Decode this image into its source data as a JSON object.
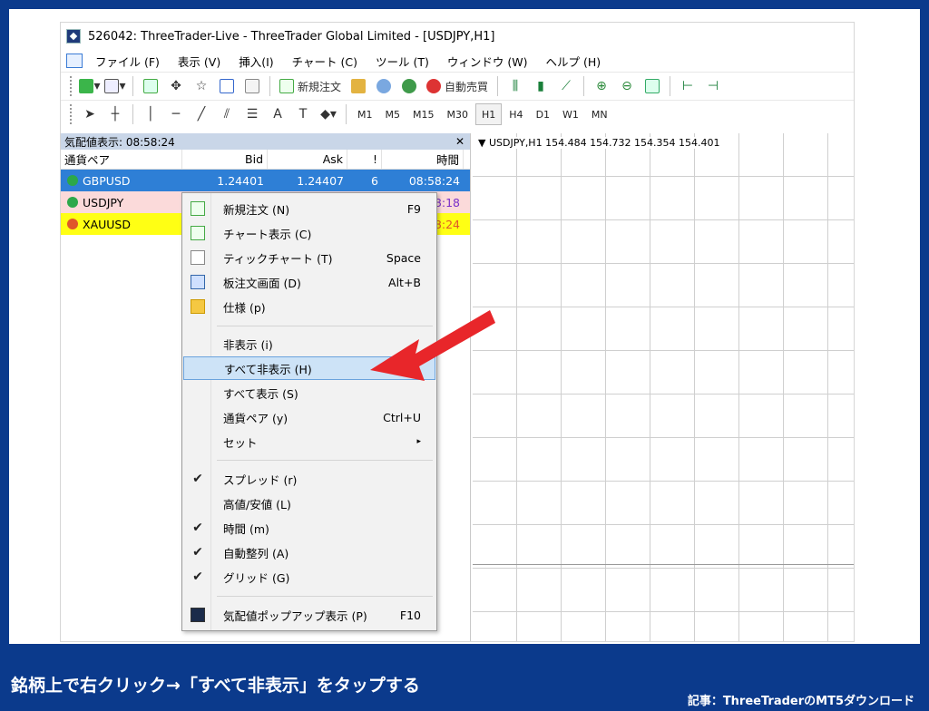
{
  "window": {
    "title": "526042: ThreeTrader-Live - ThreeTrader Global Limited - [USDJPY,H1]"
  },
  "menu": [
    "ファイル (F)",
    "表示 (V)",
    "挿入(I)",
    "チャート (C)",
    "ツール (T)",
    "ウィンドウ (W)",
    "ヘルプ (H)"
  ],
  "toolbar": {
    "new_order": "新規注文",
    "auto_trade": "自動売買"
  },
  "timeframes": [
    "M1",
    "M5",
    "M15",
    "M30",
    "H1",
    "H4",
    "D1",
    "W1",
    "MN"
  ],
  "active_timeframe": "H1",
  "market_watch": {
    "title": "気配値表示: 08:58:24",
    "columns": [
      "通貨ペア",
      "Bid",
      "Ask",
      "!",
      "時間"
    ],
    "rows": [
      {
        "symbol": "GBPUSD",
        "bid": "1.24401",
        "ask": "1.24407",
        "spread": "6",
        "time": "08:58:24"
      },
      {
        "symbol": "USDJPY",
        "time": "58:18"
      },
      {
        "symbol": "XAUUSD",
        "time": "58:24"
      }
    ],
    "colors": {
      "selected": "#2e7fd6",
      "usdjpy": "#fbdada",
      "xauusd": "#ffff14"
    }
  },
  "chart": {
    "label": "▼ USDJPY,H1  154.484 154.732 154.354 154.401"
  },
  "context_menu": {
    "items": [
      {
        "label": "新規注文 (N)",
        "shortcut": "F9"
      },
      {
        "label": "チャート表示 (C)",
        "shortcut": ""
      },
      {
        "label": "ティックチャート (T)",
        "shortcut": "Space"
      },
      {
        "label": "板注文画面 (D)",
        "shortcut": "Alt+B"
      },
      {
        "label": "仕様 (p)",
        "shortcut": ""
      },
      {
        "label": "非表示 (i)",
        "shortcut": ""
      },
      {
        "label": "すべて非表示 (H)",
        "shortcut": ""
      },
      {
        "label": "すべて表示 (S)",
        "shortcut": ""
      },
      {
        "label": "通貨ペア (y)",
        "shortcut": "Ctrl+U"
      },
      {
        "label": "セット",
        "shortcut": "▸"
      },
      {
        "label": "スプレッド (r)",
        "shortcut": ""
      },
      {
        "label": "高値/安値 (L)",
        "shortcut": ""
      },
      {
        "label": "時間 (m)",
        "shortcut": ""
      },
      {
        "label": "自動整列 (A)",
        "shortcut": ""
      },
      {
        "label": "グリッド (G)",
        "shortcut": ""
      },
      {
        "label": "気配値ポップアップ表示 (P)",
        "shortcut": "F10"
      }
    ],
    "highlighted": "すべて非表示 (H)"
  },
  "caption": "銘柄上で右クリック→「すべて非表示」をタップする",
  "source": "記事：ThreeTraderのMT5ダウンロード",
  "accent": "#e8262a"
}
